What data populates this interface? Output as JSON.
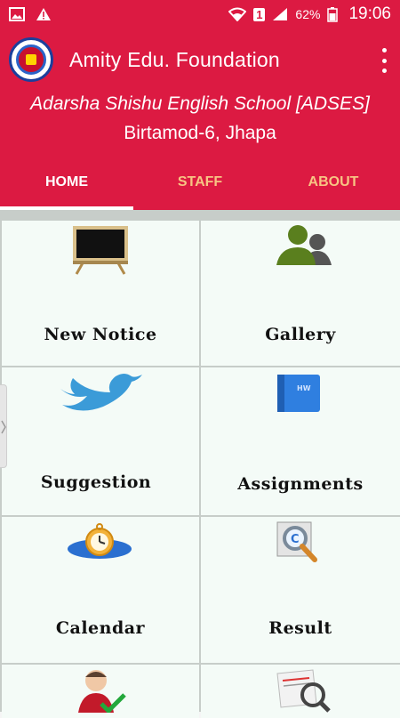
{
  "status_bar": {
    "sim": "1",
    "battery": "62%",
    "time": "19:06"
  },
  "app_bar": {
    "title": "Amity Edu. Foundation"
  },
  "header": {
    "school": "Adarsha Shishu English School [ADSES]",
    "address": "Birtamod-6, Jhapa"
  },
  "tabs": [
    {
      "label": "HOME",
      "active": true
    },
    {
      "label": "STAFF",
      "active": false
    },
    {
      "label": "ABOUT",
      "active": false
    }
  ],
  "menu": [
    {
      "label": "New Notice",
      "icon": "blackboard-icon"
    },
    {
      "label": "Gallery",
      "icon": "users-icon"
    },
    {
      "label": "Suggestion",
      "icon": "bird-icon"
    },
    {
      "label": "Assignments",
      "icon": "homework-book-icon"
    },
    {
      "label": "Calendar",
      "icon": "clock-icon"
    },
    {
      "label": "Result",
      "icon": "search-magnifier-icon"
    },
    {
      "label": "",
      "icon": "user-check-icon"
    },
    {
      "label": "",
      "icon": "document-magnifier-icon"
    }
  ],
  "colors": {
    "primary": "#dc1a42",
    "tab_inactive": "#f7c483",
    "cell_bg": "#f4fbf7"
  }
}
